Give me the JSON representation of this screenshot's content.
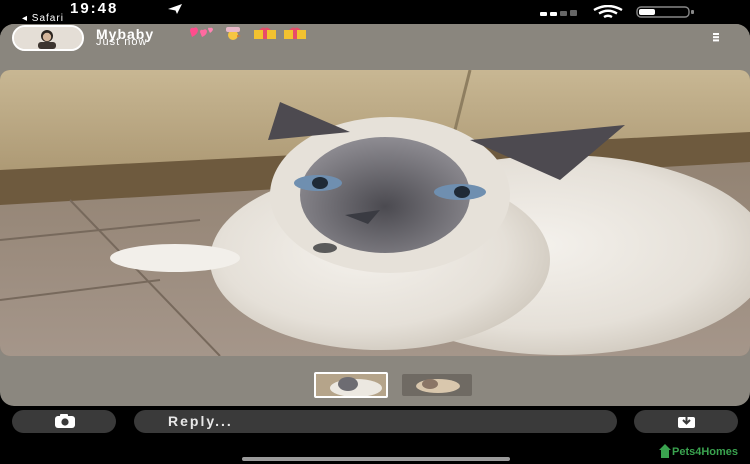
{
  "status_bar": {
    "time": "19:48",
    "back_app": "◂ Safari",
    "icons": [
      "location-arrow-icon",
      "signal-bars-icon",
      "wifi-icon",
      "battery-icon"
    ]
  },
  "story": {
    "username": "Mybaby",
    "username_decorations": [
      "hearts-emoji",
      "baby-chick-emoji",
      "gift-box-emoji",
      "gift-box-emoji"
    ],
    "timestamp": "Just now",
    "menu_icon": "more-vertical-icon",
    "photo_subject": "cat-photo",
    "thumbnails": [
      {
        "name": "story-thumb-1",
        "active": true
      },
      {
        "name": "story-thumb-2",
        "active": false
      }
    ]
  },
  "bottom_bar": {
    "camera_icon": "camera-icon",
    "reply_placeholder": "Reply...",
    "download_icon": "download-icon"
  },
  "watermark": {
    "text": "Pets4Homes"
  },
  "colors": {
    "card_background": "#8b877f",
    "control_background": "#3a3a3a",
    "watermark_green": "#3aa34f"
  }
}
